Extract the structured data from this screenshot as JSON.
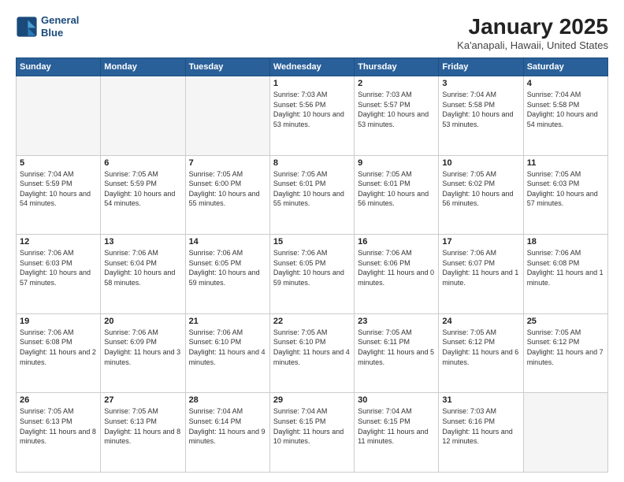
{
  "header": {
    "logo_line1": "General",
    "logo_line2": "Blue",
    "title": "January 2025",
    "subtitle": "Ka'anapali, Hawaii, United States"
  },
  "weekdays": [
    "Sunday",
    "Monday",
    "Tuesday",
    "Wednesday",
    "Thursday",
    "Friday",
    "Saturday"
  ],
  "weeks": [
    [
      {
        "day": "",
        "sunrise": "",
        "sunset": "",
        "daylight": "",
        "empty": true
      },
      {
        "day": "",
        "sunrise": "",
        "sunset": "",
        "daylight": "",
        "empty": true
      },
      {
        "day": "",
        "sunrise": "",
        "sunset": "",
        "daylight": "",
        "empty": true
      },
      {
        "day": "1",
        "sunrise": "Sunrise: 7:03 AM",
        "sunset": "Sunset: 5:56 PM",
        "daylight": "Daylight: 10 hours and 53 minutes.",
        "empty": false
      },
      {
        "day": "2",
        "sunrise": "Sunrise: 7:03 AM",
        "sunset": "Sunset: 5:57 PM",
        "daylight": "Daylight: 10 hours and 53 minutes.",
        "empty": false
      },
      {
        "day": "3",
        "sunrise": "Sunrise: 7:04 AM",
        "sunset": "Sunset: 5:58 PM",
        "daylight": "Daylight: 10 hours and 53 minutes.",
        "empty": false
      },
      {
        "day": "4",
        "sunrise": "Sunrise: 7:04 AM",
        "sunset": "Sunset: 5:58 PM",
        "daylight": "Daylight: 10 hours and 54 minutes.",
        "empty": false
      }
    ],
    [
      {
        "day": "5",
        "sunrise": "Sunrise: 7:04 AM",
        "sunset": "Sunset: 5:59 PM",
        "daylight": "Daylight: 10 hours and 54 minutes.",
        "empty": false
      },
      {
        "day": "6",
        "sunrise": "Sunrise: 7:05 AM",
        "sunset": "Sunset: 5:59 PM",
        "daylight": "Daylight: 10 hours and 54 minutes.",
        "empty": false
      },
      {
        "day": "7",
        "sunrise": "Sunrise: 7:05 AM",
        "sunset": "Sunset: 6:00 PM",
        "daylight": "Daylight: 10 hours and 55 minutes.",
        "empty": false
      },
      {
        "day": "8",
        "sunrise": "Sunrise: 7:05 AM",
        "sunset": "Sunset: 6:01 PM",
        "daylight": "Daylight: 10 hours and 55 minutes.",
        "empty": false
      },
      {
        "day": "9",
        "sunrise": "Sunrise: 7:05 AM",
        "sunset": "Sunset: 6:01 PM",
        "daylight": "Daylight: 10 hours and 56 minutes.",
        "empty": false
      },
      {
        "day": "10",
        "sunrise": "Sunrise: 7:05 AM",
        "sunset": "Sunset: 6:02 PM",
        "daylight": "Daylight: 10 hours and 56 minutes.",
        "empty": false
      },
      {
        "day": "11",
        "sunrise": "Sunrise: 7:05 AM",
        "sunset": "Sunset: 6:03 PM",
        "daylight": "Daylight: 10 hours and 57 minutes.",
        "empty": false
      }
    ],
    [
      {
        "day": "12",
        "sunrise": "Sunrise: 7:06 AM",
        "sunset": "Sunset: 6:03 PM",
        "daylight": "Daylight: 10 hours and 57 minutes.",
        "empty": false
      },
      {
        "day": "13",
        "sunrise": "Sunrise: 7:06 AM",
        "sunset": "Sunset: 6:04 PM",
        "daylight": "Daylight: 10 hours and 58 minutes.",
        "empty": false
      },
      {
        "day": "14",
        "sunrise": "Sunrise: 7:06 AM",
        "sunset": "Sunset: 6:05 PM",
        "daylight": "Daylight: 10 hours and 59 minutes.",
        "empty": false
      },
      {
        "day": "15",
        "sunrise": "Sunrise: 7:06 AM",
        "sunset": "Sunset: 6:05 PM",
        "daylight": "Daylight: 10 hours and 59 minutes.",
        "empty": false
      },
      {
        "day": "16",
        "sunrise": "Sunrise: 7:06 AM",
        "sunset": "Sunset: 6:06 PM",
        "daylight": "Daylight: 11 hours and 0 minutes.",
        "empty": false
      },
      {
        "day": "17",
        "sunrise": "Sunrise: 7:06 AM",
        "sunset": "Sunset: 6:07 PM",
        "daylight": "Daylight: 11 hours and 1 minute.",
        "empty": false
      },
      {
        "day": "18",
        "sunrise": "Sunrise: 7:06 AM",
        "sunset": "Sunset: 6:08 PM",
        "daylight": "Daylight: 11 hours and 1 minute.",
        "empty": false
      }
    ],
    [
      {
        "day": "19",
        "sunrise": "Sunrise: 7:06 AM",
        "sunset": "Sunset: 6:08 PM",
        "daylight": "Daylight: 11 hours and 2 minutes.",
        "empty": false
      },
      {
        "day": "20",
        "sunrise": "Sunrise: 7:06 AM",
        "sunset": "Sunset: 6:09 PM",
        "daylight": "Daylight: 11 hours and 3 minutes.",
        "empty": false
      },
      {
        "day": "21",
        "sunrise": "Sunrise: 7:06 AM",
        "sunset": "Sunset: 6:10 PM",
        "daylight": "Daylight: 11 hours and 4 minutes.",
        "empty": false
      },
      {
        "day": "22",
        "sunrise": "Sunrise: 7:05 AM",
        "sunset": "Sunset: 6:10 PM",
        "daylight": "Daylight: 11 hours and 4 minutes.",
        "empty": false
      },
      {
        "day": "23",
        "sunrise": "Sunrise: 7:05 AM",
        "sunset": "Sunset: 6:11 PM",
        "daylight": "Daylight: 11 hours and 5 minutes.",
        "empty": false
      },
      {
        "day": "24",
        "sunrise": "Sunrise: 7:05 AM",
        "sunset": "Sunset: 6:12 PM",
        "daylight": "Daylight: 11 hours and 6 minutes.",
        "empty": false
      },
      {
        "day": "25",
        "sunrise": "Sunrise: 7:05 AM",
        "sunset": "Sunset: 6:12 PM",
        "daylight": "Daylight: 11 hours and 7 minutes.",
        "empty": false
      }
    ],
    [
      {
        "day": "26",
        "sunrise": "Sunrise: 7:05 AM",
        "sunset": "Sunset: 6:13 PM",
        "daylight": "Daylight: 11 hours and 8 minutes.",
        "empty": false
      },
      {
        "day": "27",
        "sunrise": "Sunrise: 7:05 AM",
        "sunset": "Sunset: 6:13 PM",
        "daylight": "Daylight: 11 hours and 8 minutes.",
        "empty": false
      },
      {
        "day": "28",
        "sunrise": "Sunrise: 7:04 AM",
        "sunset": "Sunset: 6:14 PM",
        "daylight": "Daylight: 11 hours and 9 minutes.",
        "empty": false
      },
      {
        "day": "29",
        "sunrise": "Sunrise: 7:04 AM",
        "sunset": "Sunset: 6:15 PM",
        "daylight": "Daylight: 11 hours and 10 minutes.",
        "empty": false
      },
      {
        "day": "30",
        "sunrise": "Sunrise: 7:04 AM",
        "sunset": "Sunset: 6:15 PM",
        "daylight": "Daylight: 11 hours and 11 minutes.",
        "empty": false
      },
      {
        "day": "31",
        "sunrise": "Sunrise: 7:03 AM",
        "sunset": "Sunset: 6:16 PM",
        "daylight": "Daylight: 11 hours and 12 minutes.",
        "empty": false
      },
      {
        "day": "",
        "sunrise": "",
        "sunset": "",
        "daylight": "",
        "empty": true
      }
    ]
  ]
}
